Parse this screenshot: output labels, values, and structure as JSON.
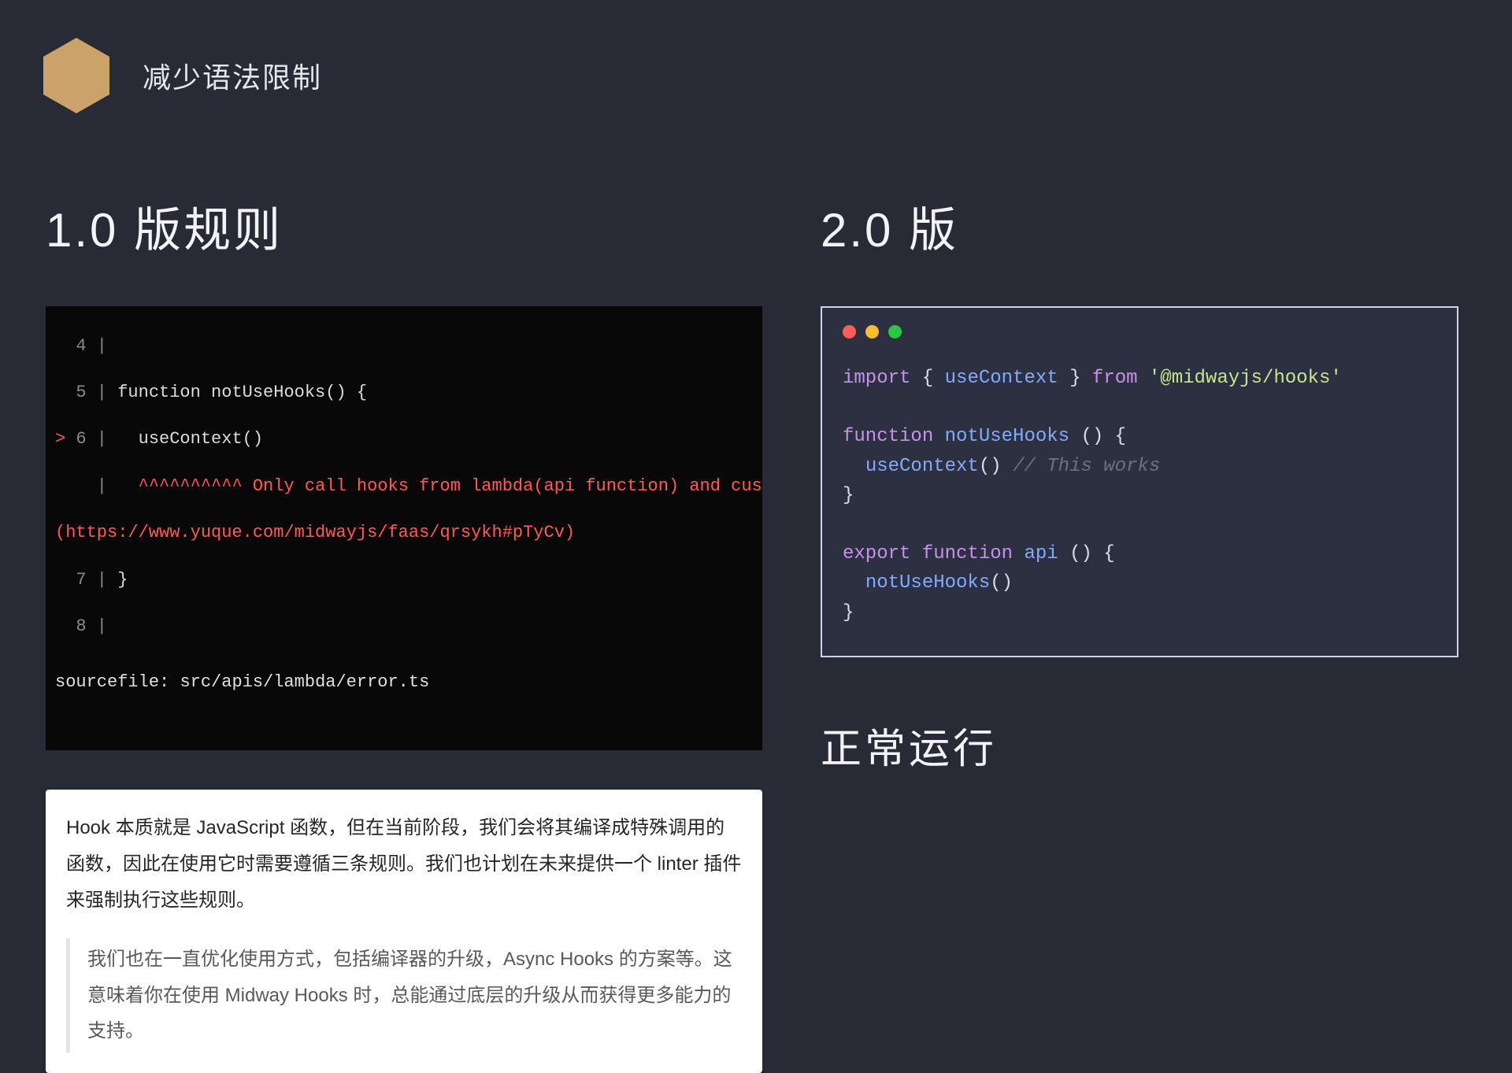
{
  "header": {
    "title": "减少语法限制"
  },
  "left": {
    "heading": "1.0 版规则",
    "terminal": {
      "lines": [
        {
          "num": "4",
          "gutter": " |",
          "text": ""
        },
        {
          "num": "5",
          "gutter": " | ",
          "text": "function notUseHooks() {"
        },
        {
          "num": "6",
          "prefix": "> ",
          "gutter": " |   ",
          "text": "useContext()"
        },
        {
          "num": " ",
          "gutter": " |   ",
          "caret": "^^^^^^^^^^",
          "err_tail": " Only call hooks from lambda(api function) and custom hooks"
        },
        {
          "err_full": "(https://www.yuque.com/midwayjs/faas/qrsykh#pTyCv)"
        },
        {
          "num": "7",
          "gutter": " | ",
          "text": "}"
        },
        {
          "num": "8",
          "gutter": " |",
          "text": ""
        }
      ],
      "sourcefile_label": "sourcefile: ",
      "sourcefile_path": "src/apis/lambda/error.ts"
    },
    "doc": {
      "para": "Hook 本质就是 JavaScript 函数，但在当前阶段，我们会将其编译成特殊调用的函数，因此在使用它时需要遵循三条规则。我们也计划在未来提供一个 linter 插件来强制执行这些规则。",
      "quote": "我们也在一直优化使用方式，包括编译器的升级，Async Hooks 的方案等。这意味着你在使用 Midway Hooks 时，总能通过底层的升级从而获得更多能力的支持。"
    }
  },
  "right": {
    "heading": "2.0 版",
    "code": {
      "t_import": "import",
      "t_from": "from",
      "t_function": "function",
      "t_export": "export",
      "imp_open": " { ",
      "imp_name": "useContext",
      "imp_close": " } ",
      "pkg": "'@midwayjs/hooks'",
      "fn1_name": "notUseHooks",
      "fn1_sig": " () {",
      "call1": "useContext",
      "call1_parens": "() ",
      "cmt_works": "// This works",
      "brace_close": "}",
      "fn2_name": "api",
      "fn2_sig": " () {",
      "call2": "notUseHooks",
      "call2_parens": "()"
    },
    "caption": "正常运行"
  }
}
